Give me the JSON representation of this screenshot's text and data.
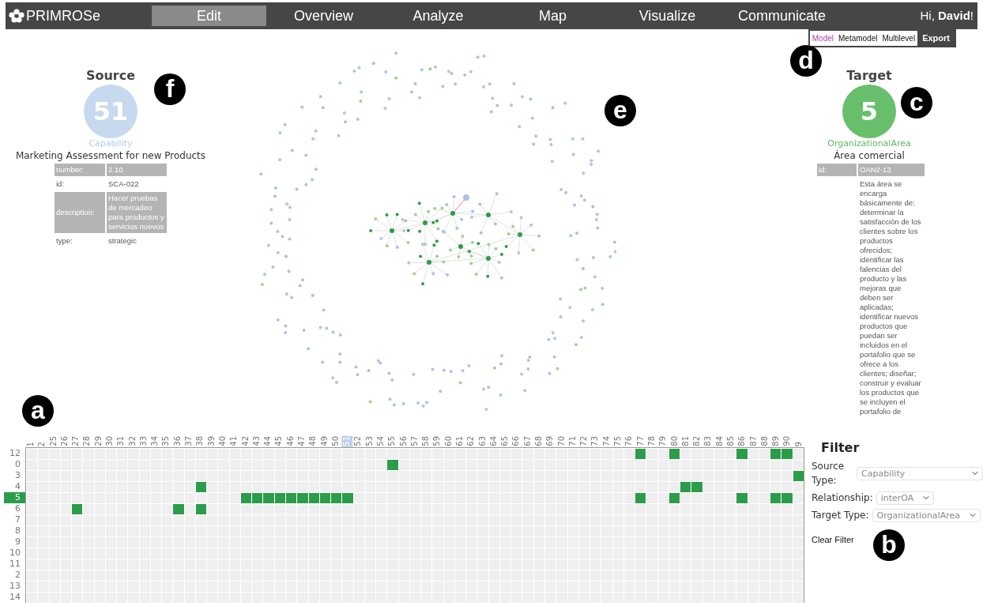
{
  "brand": {
    "name": "PRIMROSe"
  },
  "nav": [
    {
      "label": "Edit",
      "selected": true
    },
    {
      "label": "Overview",
      "selected": false
    },
    {
      "label": "Analyze",
      "selected": false
    },
    {
      "label": "Map",
      "selected": false
    },
    {
      "label": "Visualize",
      "selected": false
    },
    {
      "label": "Communicate",
      "selected": false
    }
  ],
  "greeting": "Hi, **David**!",
  "view_modes": [
    {
      "label": "Model",
      "selected": true
    },
    {
      "label": "Metamodel",
      "selected": false
    },
    {
      "label": "Multilevel",
      "selected": false
    }
  ],
  "export_button": "Export",
  "source": {
    "heading": "Source",
    "count": "51",
    "type": "Capability",
    "name": "Marketing Assessment for new Products",
    "properties": [
      {
        "key": "number:",
        "value": "2.10"
      },
      {
        "key": "id:",
        "value": "SCA-022"
      },
      {
        "key": "description:",
        "value": "Hacer pruebas de mercadeo para productos y servicios nuevos"
      },
      {
        "key": "type:",
        "value": "strategic"
      }
    ]
  },
  "target": {
    "heading": "Target",
    "count": "5",
    "type": "OrganizationalArea",
    "name": "Área comercial",
    "properties": [
      {
        "key": "id:",
        "value": "OAN2-13"
      },
      {
        "value": "Esta área se encarga básicamente de: determinar la satisfacción de los clientes sobre los productos ofrecidos; identificar las falencias del producto y las mejoras que deben ser aplicadas; identificar nuevos productos que puedan ser incluidos en el portafolio que se ofrece a los clientes; diseñar; construir y evaluar los productos que se incluyen el portafolio de"
      }
    ]
  },
  "matrix": {
    "columns": [
      {
        "label": "1",
        "selected": false
      },
      {
        "label": "2",
        "selected": false
      },
      {
        "label": "25",
        "selected": false
      },
      {
        "label": "26",
        "selected": false
      },
      {
        "label": "27",
        "selected": false
      },
      {
        "label": "28",
        "selected": false
      },
      {
        "label": "29",
        "selected": false
      },
      {
        "label": "30",
        "selected": false
      },
      {
        "label": "31",
        "selected": false
      },
      {
        "label": "32",
        "selected": false
      },
      {
        "label": "33",
        "selected": false
      },
      {
        "label": "34",
        "selected": false
      },
      {
        "label": "35",
        "selected": false
      },
      {
        "label": "36",
        "selected": false
      },
      {
        "label": "37",
        "selected": false
      },
      {
        "label": "38",
        "selected": false
      },
      {
        "label": "39",
        "selected": false
      },
      {
        "label": "40",
        "selected": false
      },
      {
        "label": "41",
        "selected": false
      },
      {
        "label": "42",
        "selected": false
      },
      {
        "label": "43",
        "selected": false
      },
      {
        "label": "44",
        "selected": false
      },
      {
        "label": "45",
        "selected": false
      },
      {
        "label": "46",
        "selected": false
      },
      {
        "label": "47",
        "selected": false
      },
      {
        "label": "48",
        "selected": false
      },
      {
        "label": "49",
        "selected": false
      },
      {
        "label": "50",
        "selected": false
      },
      {
        "label": "51",
        "selected": true
      },
      {
        "label": "52",
        "selected": false
      },
      {
        "label": "53",
        "selected": false
      },
      {
        "label": "54",
        "selected": false
      },
      {
        "label": "55",
        "selected": false
      },
      {
        "label": "56",
        "selected": false
      },
      {
        "label": "57",
        "selected": false
      },
      {
        "label": "58",
        "selected": false
      },
      {
        "label": "59",
        "selected": false
      },
      {
        "label": "60",
        "selected": false
      },
      {
        "label": "61",
        "selected": false
      },
      {
        "label": "62",
        "selected": false
      },
      {
        "label": "63",
        "selected": false
      },
      {
        "label": "64",
        "selected": false
      },
      {
        "label": "65",
        "selected": false
      },
      {
        "label": "66",
        "selected": false
      },
      {
        "label": "67",
        "selected": false
      },
      {
        "label": "68",
        "selected": false
      },
      {
        "label": "69",
        "selected": false
      },
      {
        "label": "70",
        "selected": false
      },
      {
        "label": "71",
        "selected": false
      },
      {
        "label": "72",
        "selected": false
      },
      {
        "label": "73",
        "selected": false
      },
      {
        "label": "74",
        "selected": false
      },
      {
        "label": "75",
        "selected": false
      },
      {
        "label": "76",
        "selected": false
      },
      {
        "label": "77",
        "selected": false
      },
      {
        "label": "78",
        "selected": false
      },
      {
        "label": "79",
        "selected": false
      },
      {
        "label": "80",
        "selected": false
      },
      {
        "label": "81",
        "selected": false
      },
      {
        "label": "82",
        "selected": false
      },
      {
        "label": "83",
        "selected": false
      },
      {
        "label": "84",
        "selected": false
      },
      {
        "label": "85",
        "selected": false
      },
      {
        "label": "86",
        "selected": false
      },
      {
        "label": "87",
        "selected": false
      },
      {
        "label": "88",
        "selected": false
      },
      {
        "label": "89",
        "selected": false
      },
      {
        "label": "90",
        "selected": false
      },
      {
        "label": "9",
        "selected": false
      }
    ],
    "rows": [
      {
        "label": "12",
        "selected": false,
        "cells": [
          false,
          false,
          false,
          false,
          false,
          false,
          false,
          false,
          false,
          false,
          false,
          false,
          false,
          false,
          false,
          false,
          false,
          false,
          false,
          false,
          false,
          false,
          false,
          false,
          false,
          false,
          false,
          false,
          false,
          false,
          false,
          false,
          false,
          false,
          false,
          false,
          false,
          false,
          false,
          false,
          false,
          false,
          false,
          false,
          false,
          false,
          false,
          false,
          false,
          false,
          false,
          false,
          false,
          false,
          true,
          false,
          false,
          true,
          false,
          false,
          false,
          false,
          false,
          true,
          false,
          false,
          true,
          true,
          false
        ]
      },
      {
        "label": "0",
        "selected": false,
        "cells": [
          false,
          false,
          false,
          false,
          false,
          false,
          false,
          false,
          false,
          false,
          false,
          false,
          false,
          false,
          false,
          false,
          false,
          false,
          false,
          false,
          false,
          false,
          false,
          false,
          false,
          false,
          false,
          false,
          false,
          false,
          false,
          false,
          true,
          false,
          false,
          false,
          false,
          false,
          false,
          false,
          false,
          false,
          false,
          false,
          false,
          false,
          false,
          false,
          false,
          false,
          false,
          false,
          false,
          false,
          false,
          false,
          false,
          false,
          false,
          false,
          false,
          false,
          false,
          false,
          false,
          false,
          false,
          false,
          false
        ]
      },
      {
        "label": "3",
        "selected": false,
        "cells": [
          false,
          false,
          false,
          false,
          false,
          false,
          false,
          false,
          false,
          false,
          false,
          false,
          false,
          false,
          false,
          false,
          false,
          false,
          false,
          false,
          false,
          false,
          false,
          false,
          false,
          false,
          false,
          false,
          false,
          false,
          false,
          false,
          false,
          false,
          false,
          false,
          false,
          false,
          false,
          false,
          false,
          false,
          false,
          false,
          false,
          false,
          false,
          false,
          false,
          false,
          false,
          false,
          false,
          false,
          false,
          false,
          false,
          false,
          false,
          false,
          false,
          false,
          false,
          false,
          false,
          false,
          false,
          false,
          true
        ]
      },
      {
        "label": "4",
        "selected": false,
        "cells": [
          false,
          false,
          false,
          false,
          false,
          false,
          false,
          false,
          false,
          false,
          false,
          false,
          false,
          false,
          false,
          true,
          false,
          false,
          false,
          false,
          false,
          false,
          false,
          false,
          false,
          false,
          false,
          false,
          false,
          false,
          false,
          false,
          false,
          false,
          false,
          false,
          false,
          false,
          false,
          false,
          false,
          false,
          false,
          false,
          false,
          false,
          false,
          false,
          false,
          false,
          false,
          false,
          false,
          false,
          false,
          false,
          false,
          false,
          true,
          true,
          false,
          false,
          false,
          false,
          false,
          false,
          false,
          false,
          false
        ]
      },
      {
        "label": "5",
        "selected": true,
        "cells": [
          false,
          false,
          false,
          false,
          false,
          false,
          false,
          false,
          false,
          false,
          false,
          false,
          false,
          false,
          false,
          false,
          false,
          false,
          false,
          true,
          true,
          true,
          true,
          true,
          true,
          true,
          true,
          true,
          true,
          false,
          false,
          false,
          false,
          false,
          false,
          false,
          false,
          false,
          false,
          false,
          false,
          false,
          false,
          false,
          false,
          false,
          false,
          false,
          false,
          false,
          false,
          false,
          false,
          false,
          true,
          false,
          false,
          true,
          false,
          false,
          false,
          false,
          false,
          true,
          false,
          false,
          true,
          true,
          false
        ]
      },
      {
        "label": "6",
        "selected": false,
        "cells": [
          false,
          false,
          false,
          false,
          true,
          false,
          false,
          false,
          false,
          false,
          false,
          false,
          false,
          true,
          false,
          true,
          false,
          false,
          false,
          false,
          false,
          false,
          false,
          false,
          false,
          false,
          false,
          false,
          false,
          false,
          false,
          false,
          false,
          false,
          false,
          false,
          false,
          false,
          false,
          false,
          false,
          false,
          false,
          false,
          false,
          false,
          false,
          false,
          false,
          false,
          false,
          false,
          false,
          false,
          false,
          false,
          false,
          false,
          false,
          false,
          false,
          false,
          false,
          false,
          false,
          false,
          false,
          false,
          false
        ]
      },
      {
        "label": "7",
        "selected": false
      },
      {
        "label": "8",
        "selected": false
      },
      {
        "label": "9",
        "selected": false
      },
      {
        "label": "10",
        "selected": false
      },
      {
        "label": "11",
        "selected": false
      },
      {
        "label": "2",
        "selected": false
      },
      {
        "label": "13",
        "selected": false
      },
      {
        "label": "14",
        "selected": false
      }
    ]
  },
  "filter": {
    "title": "Filter",
    "fields": [
      {
        "label": "Source Type:",
        "value": "Capability"
      },
      {
        "label": "Relationship:",
        "value": "interOA"
      },
      {
        "label": "Target Type:",
        "value": "OrganizationalArea"
      }
    ],
    "clear_button": "Clear Filter"
  },
  "callouts": [
    {
      "label": "f"
    },
    {
      "label": "e"
    },
    {
      "label": "d"
    },
    {
      "label": "c"
    },
    {
      "label": "a"
    },
    {
      "label": "b"
    }
  ]
}
